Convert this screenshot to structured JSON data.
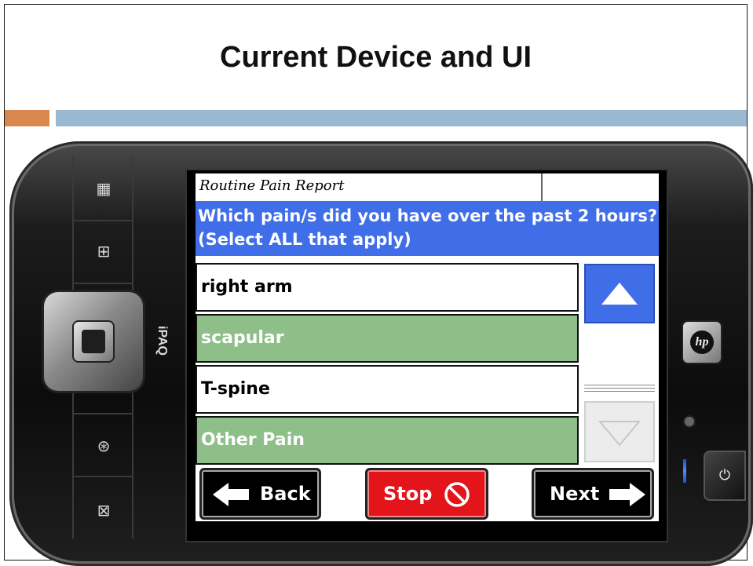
{
  "slide": {
    "title": "Current Device and UI"
  },
  "device": {
    "brand": "iPAQ",
    "logo": "hp"
  },
  "app": {
    "window_title": "Routine Pain Report",
    "question": "Which pain/s did you have over the past 2 hours? (Select ALL that apply)",
    "options": [
      {
        "label": "right arm",
        "selected": false
      },
      {
        "label": "scapular",
        "selected": true
      },
      {
        "label": "T-spine",
        "selected": false
      },
      {
        "label": "Other Pain",
        "selected": true
      }
    ],
    "nav": {
      "back_label": "Back",
      "stop_label": "Stop",
      "next_label": "Next"
    }
  },
  "colors": {
    "accent_blue": "#3f6ee8",
    "selected_green": "#8fbf89",
    "stop_red": "#e3141a",
    "slide_orange": "#d9864f",
    "slide_blue": "#9bb8d3"
  },
  "icons": {
    "scroll_up": "triangle-up-icon",
    "scroll_down": "triangle-down-icon",
    "back": "arrow-left-icon",
    "stop": "prohibited-icon",
    "next": "arrow-right-icon"
  }
}
